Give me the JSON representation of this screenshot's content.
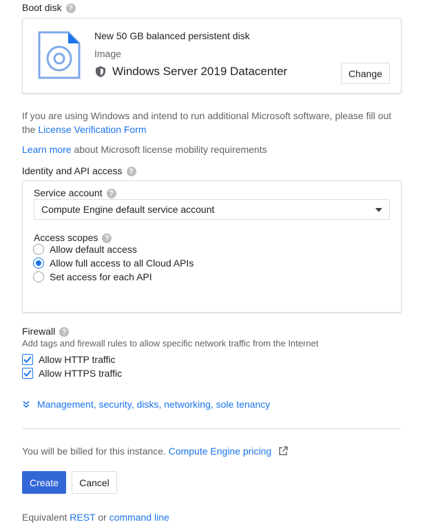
{
  "boot_disk": {
    "title": "Boot disk",
    "disk_name": "New 50 GB balanced persistent disk",
    "image_label": "Image",
    "image_name": "Windows Server 2019 Datacenter",
    "change_label": "Change"
  },
  "license": {
    "text": "If you are using Windows and intend to run additional Microsoft software, please fill out the ",
    "link": "License Verification Form",
    "learn_more_link": "Learn more",
    "learn_more_text": " about Microsoft license mobility requirements"
  },
  "identity": {
    "title": "Identity and API access",
    "service_account_label": "Service account",
    "service_account_value": "Compute Engine default service account",
    "access_scopes_label": "Access scopes",
    "scopes": [
      {
        "label": "Allow default access",
        "checked": false
      },
      {
        "label": "Allow full access to all Cloud APIs",
        "checked": true
      },
      {
        "label": "Set access for each API",
        "checked": false
      }
    ]
  },
  "firewall": {
    "title": "Firewall",
    "description": "Add tags and firewall rules to allow specific network traffic from the Internet",
    "options": [
      {
        "label": "Allow HTTP traffic",
        "checked": true
      },
      {
        "label": "Allow HTTPS traffic",
        "checked": true
      }
    ]
  },
  "management_link": "Management, security, disks, networking, sole tenancy",
  "billing": {
    "text": "You will be billed for this instance. ",
    "link": "Compute Engine pricing"
  },
  "actions": {
    "create_label": "Create",
    "cancel_label": "Cancel"
  },
  "equivalent": {
    "prefix": "Equivalent ",
    "rest_link": "REST",
    "or_text": " or ",
    "cmd_link": "command line"
  },
  "colors": {
    "accent": "#1a73e8",
    "primary_button": "#3367d6",
    "help_icon": "#bdbdbd"
  }
}
